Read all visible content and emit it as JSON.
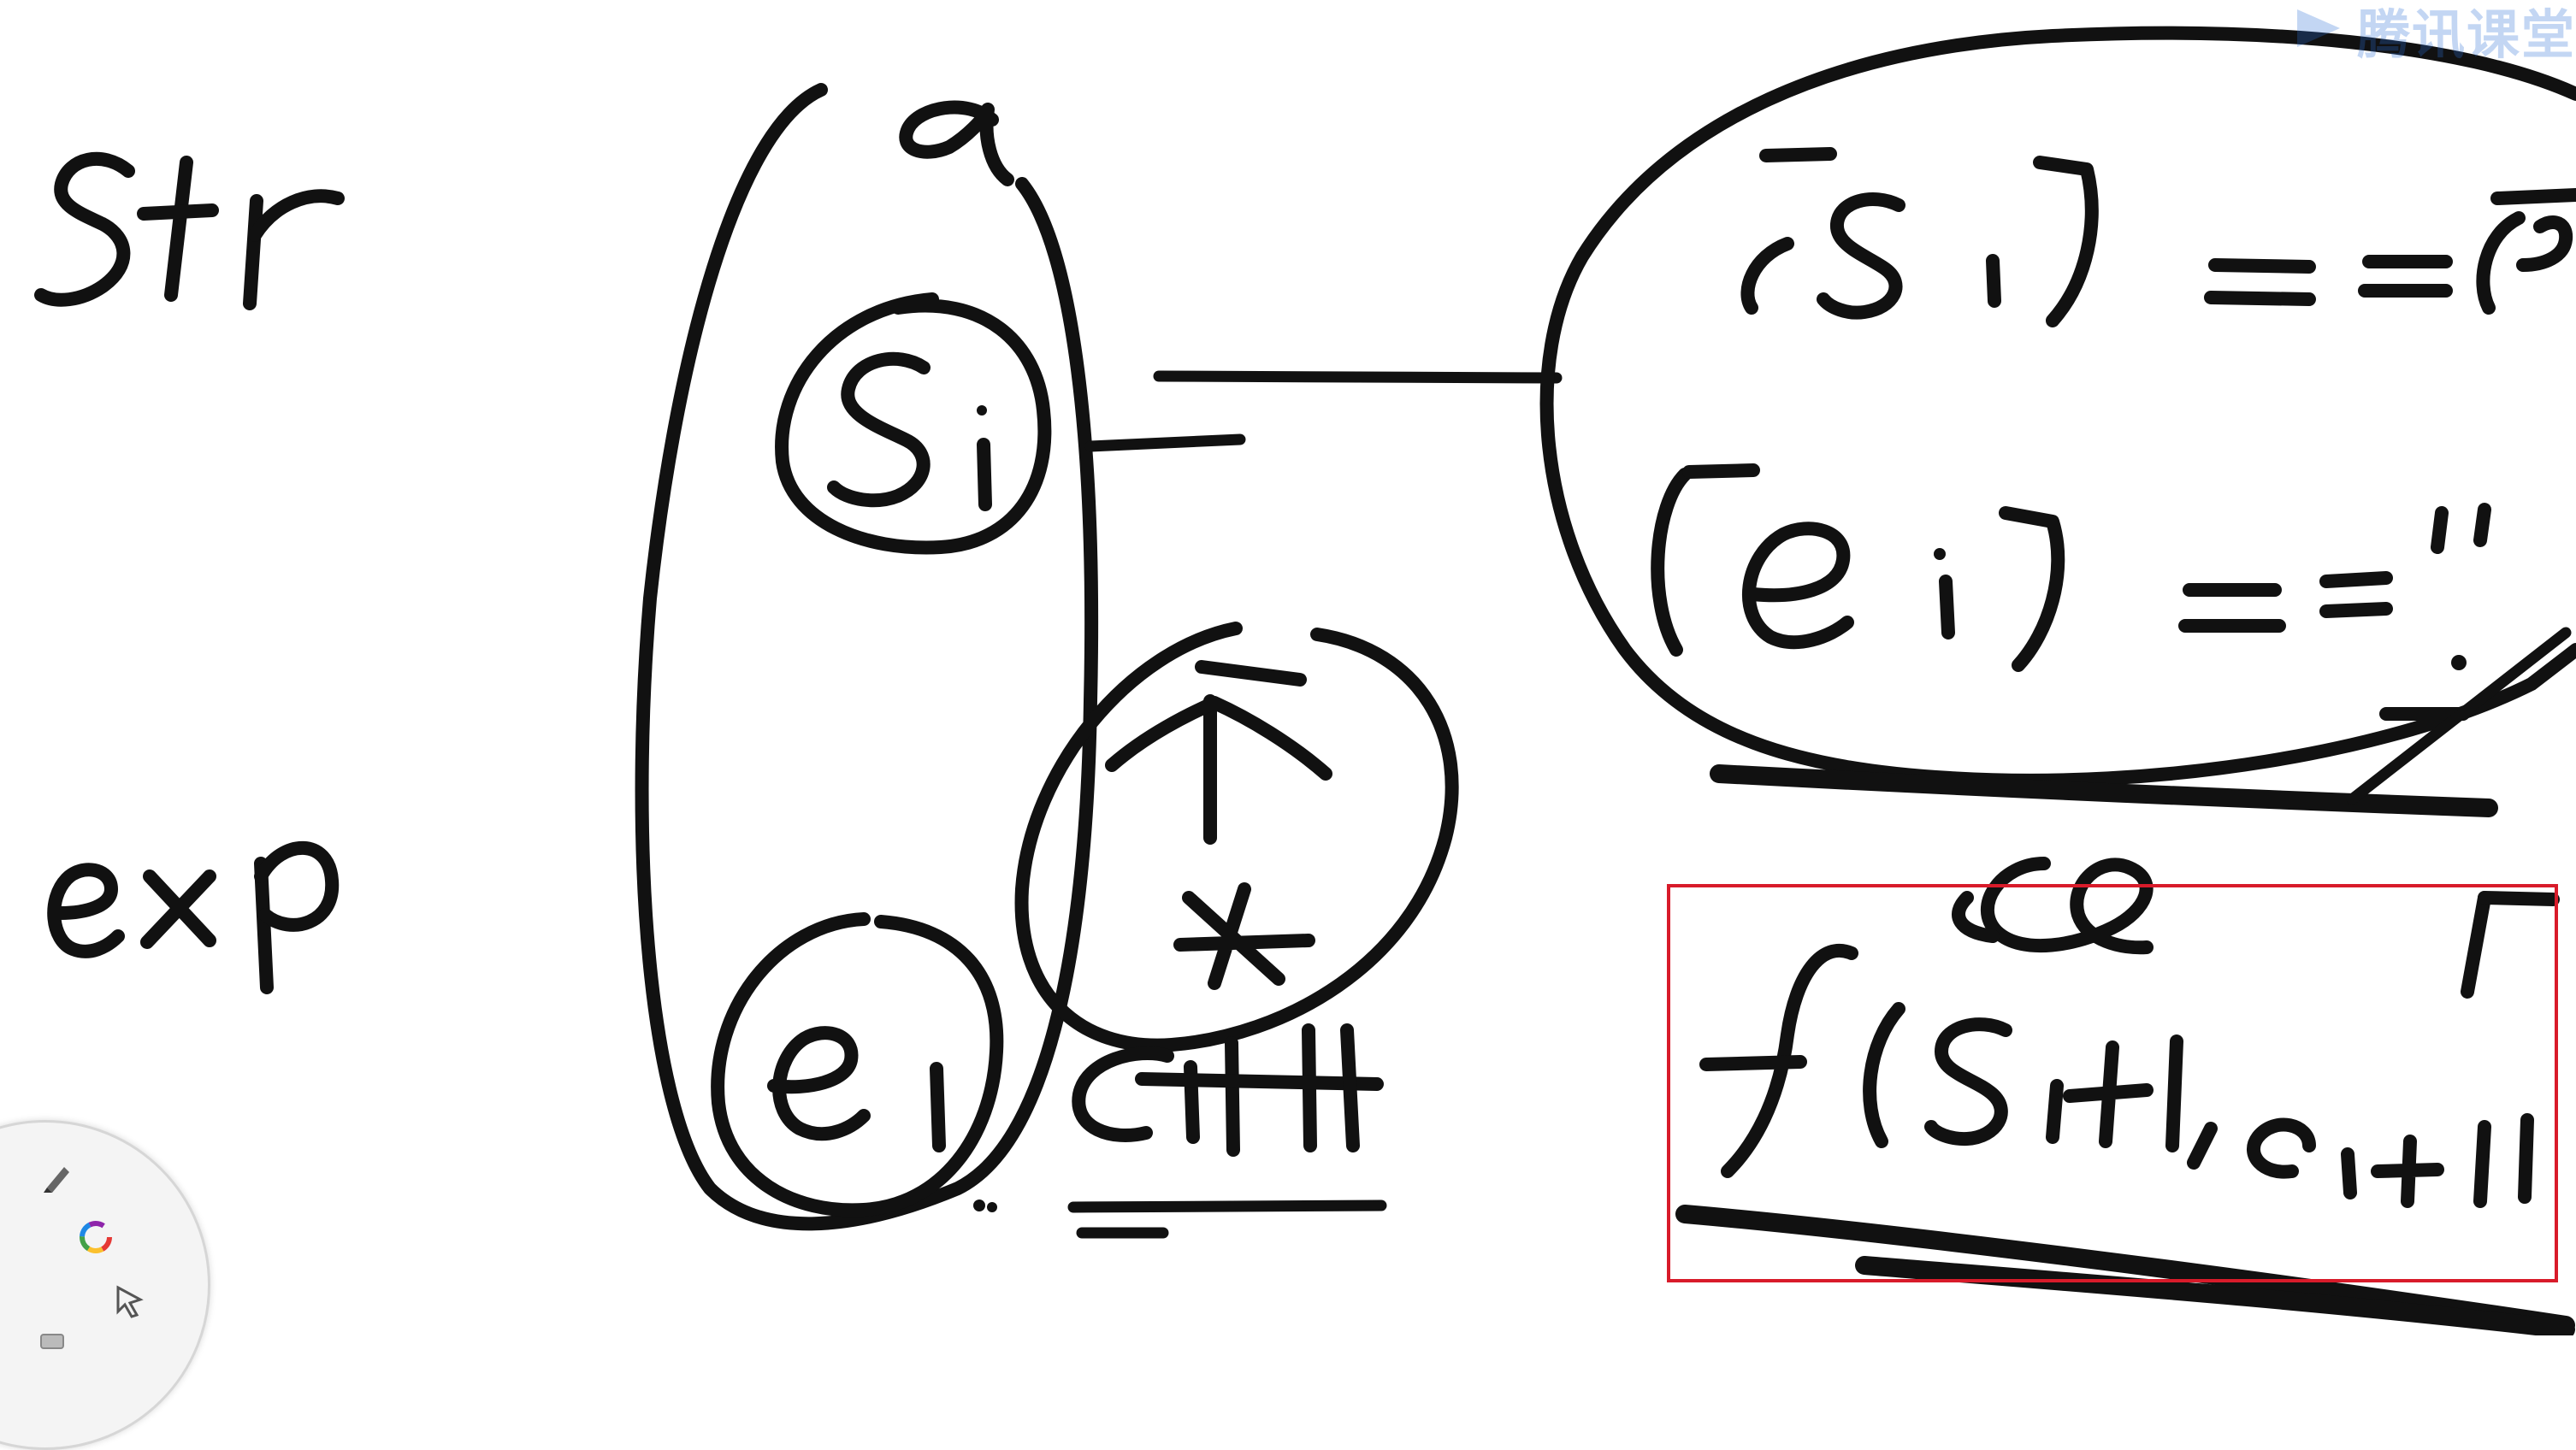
{
  "window": {
    "watermark_text": "腾讯课堂"
  },
  "whiteboard": {
    "background": "#ffffff",
    "ink_color": "#111111",
    "selection_color": "#d81b2a"
  },
  "toolbar": {
    "tools": [
      {
        "name": "pen-tool-icon",
        "icon": "pen"
      },
      {
        "name": "color-wheel-icon",
        "icon": "color-wheel"
      },
      {
        "name": "select-arrow-icon",
        "icon": "cursor-arrow"
      },
      {
        "name": "eraser-icon",
        "icon": "eraser"
      }
    ]
  }
}
